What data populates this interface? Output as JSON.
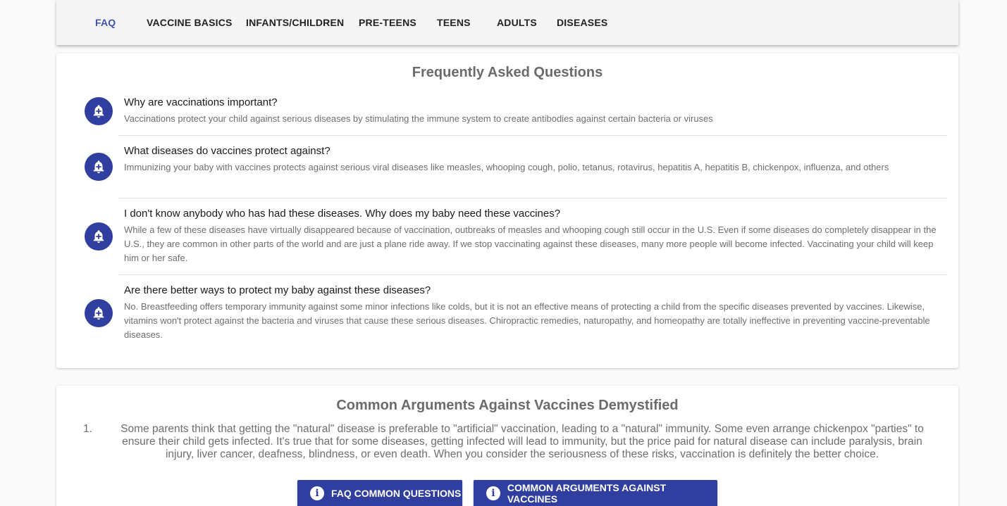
{
  "nav": {
    "tabs": [
      {
        "label": "FAQ",
        "active": true
      },
      {
        "label": "VACCINE BASICS",
        "active": false
      },
      {
        "label": "INFANTS/CHILDREN",
        "active": false
      },
      {
        "label": "PRE-TEENS",
        "active": false
      },
      {
        "label": "TEENS",
        "active": false
      },
      {
        "label": "ADULTS",
        "active": false
      },
      {
        "label": "DISEASES",
        "active": false
      }
    ]
  },
  "faq": {
    "title": "Frequently Asked Questions",
    "icon": "bell-plus-icon",
    "items": [
      {
        "question": "Why are vaccinations important?",
        "answer": "Vaccinations protect your child against serious diseases by stimulating the immune system to create antibodies against certain bacteria or viruses"
      },
      {
        "question": "What diseases do vaccines protect against?",
        "answer": "Immunizing your baby with vaccines protects against serious viral diseases like measles, whooping cough, polio, tetanus, rotavirus, hepatitis A, hepatitis B, chickenpox, influenza, and others"
      },
      {
        "question": "I don't know anybody who has had these diseases. Why does my baby need these vaccines?",
        "answer": "While a few of these diseases have virtually disappeared because of vaccination, outbreaks of measles and whooping cough still occur in the U.S. Even if some diseases do completely disappear in the U.S., they are common in other parts of the world and are just a plane ride away. If we stop vaccinating against these diseases, many more people will become infected. Vaccinating your child will keep him or her safe."
      },
      {
        "question": "Are there better ways to protect my baby against these diseases?",
        "answer": "No. Breastfeeding offers temporary immunity against some minor infections like colds, but it is not an effective means of protecting a child from the specific diseases prevented by vaccines. Likewise, vitamins won't protect against the bacteria and viruses that cause these serious diseases. Chiropractic remedies, naturopathy, and homeopathy are totally ineffective in preventing vaccine-preventable diseases."
      }
    ]
  },
  "arguments": {
    "title": "Common Arguments Against Vaccines Demystified",
    "items": [
      {
        "number": "1.",
        "text": "Some parents think that getting the \"natural\" disease is preferable to \"artificial\" vaccination, leading to a \"natural\" immunity. Some even arrange chickenpox \"parties\" to ensure their child gets infected. It's true that for some diseases, getting infected will lead to immunity, but the price paid for natural disease can include paralysis, brain injury, liver cancer, deafness, blindness, or even death. When you consider the seriousness of these risks, vaccination is definitely the better choice."
      }
    ]
  },
  "buttons": {
    "faq_label": "FAQ COMMON QUESTIONS",
    "args_label": "COMMON ARGUMENTS AGAINST VACCINES",
    "icon": "info-icon"
  },
  "colors": {
    "accent": "#3f51b5",
    "button": "#303f9f"
  }
}
